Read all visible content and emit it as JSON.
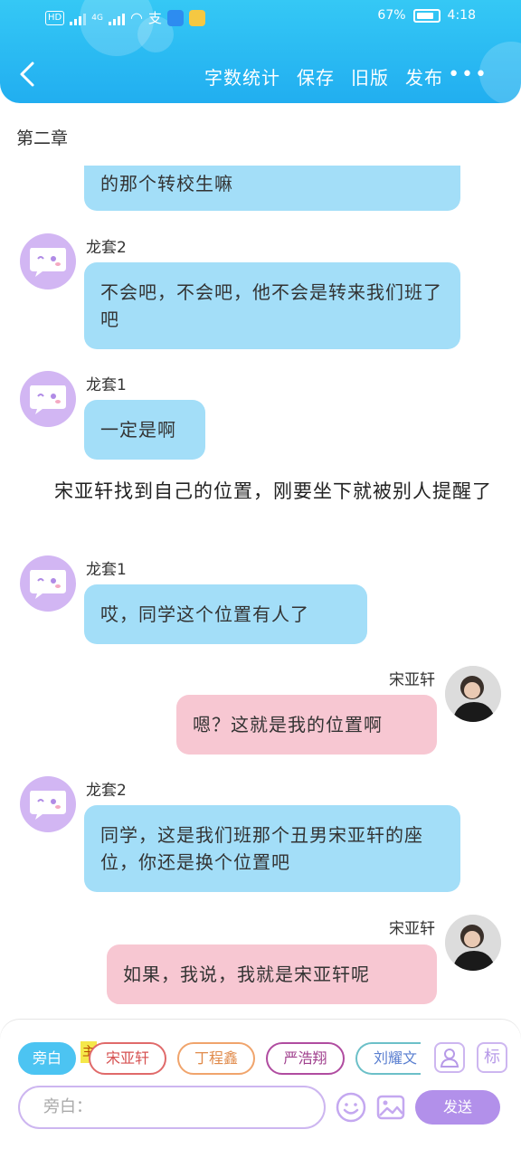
{
  "status_bar": {
    "network": "4G",
    "battery_text": "67%",
    "time": "4:18"
  },
  "navbar": {
    "actions": [
      "字数统计",
      "保存",
      "旧版",
      "发布"
    ],
    "more": "•••"
  },
  "chapter_title": "第二章",
  "messages": [
    {
      "speaker": "",
      "text": "的那个转校生嘛"
    },
    {
      "speaker": "龙套2",
      "text": "不会吧，不会吧，他不会是转来我们班了吧"
    },
    {
      "speaker": "龙套1",
      "text": "一定是啊"
    },
    {
      "speaker": "龙套1",
      "text": "哎，同学这个位置有人了"
    },
    {
      "speaker": "宋亚轩",
      "text": "嗯？这就是我的位置啊"
    },
    {
      "speaker": "龙套2",
      "text": "同学，这是我们班那个丑男宋亚轩的座位，你还是换个位置吧"
    },
    {
      "speaker": "宋亚轩",
      "text": "如果，我说，我就是宋亚轩呢"
    }
  ],
  "narration": "宋亚轩找到自己的位置，刚要坐下就被别人提醒了",
  "bottom_panel": {
    "roles": [
      "旁白",
      "宋亚轩",
      "丁程鑫",
      "严浩翔",
      "刘耀文"
    ],
    "protagonist_tag": "主",
    "label_icon": "标",
    "input_placeholder": "旁白：",
    "send_label": "发送"
  },
  "colors": {
    "header": "#21aef0",
    "bubble_other": "#a3def8",
    "bubble_self": "#f7c7d2",
    "accent_purple": "#b290ea"
  }
}
